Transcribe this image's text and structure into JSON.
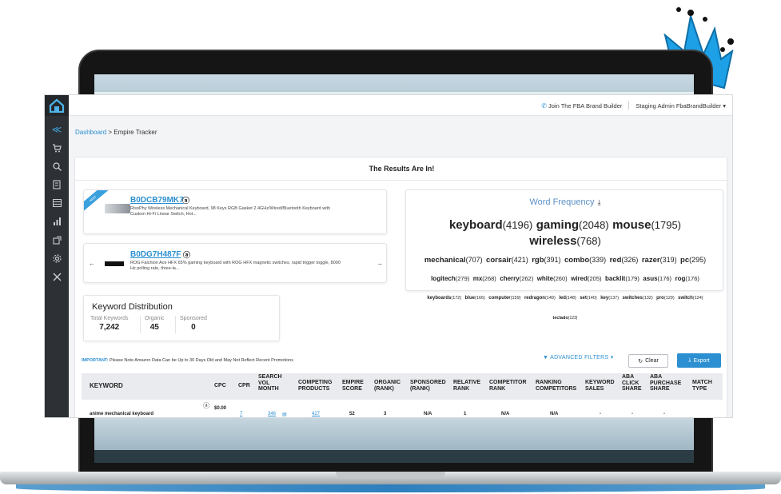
{
  "topbar": {
    "join_label": "Join The FBA Brand Builder",
    "user_label": "Staging Admin FbaBrandBuilder"
  },
  "breadcrumb": {
    "root": "Dashboard",
    "separator": ">",
    "current": "Empire Tracker"
  },
  "results_title": "The Results Are In!",
  "products": [
    {
      "asin": "B0DCB79MK7",
      "badge": "ⓐ",
      "ribbon": "NEW",
      "description_line1": "RisoPhy Wireless Mechanical Keyboard, 98 Keys RGB Gasket 2.4GHz/Wired/Bluetooth Keyboard with",
      "description_line2": "Custom Hi-Fi Linear Switch, Hot..."
    },
    {
      "asin": "B0DG7H487F",
      "badge": "ⓐ",
      "description_line1": "ROG Falchion Ace HFX 65% gaming keyboard with ROG HFX magnetic switches, rapid trigger toggle, 8000",
      "description_line2": "Hz polling rate, three-la..."
    }
  ],
  "word_frequency": {
    "title": "Word Frequency",
    "download_glyph": "⤓",
    "rows": [
      [
        {
          "word": "keyboard",
          "count": "(4196)"
        },
        {
          "word": "gaming",
          "count": "(2048)"
        },
        {
          "word": "mouse",
          "count": "(1795)"
        },
        {
          "word": "wireless",
          "count": "(768)"
        }
      ],
      [
        {
          "word": "mechanical",
          "count": "(707)"
        },
        {
          "word": "corsair",
          "count": "(421)"
        },
        {
          "word": "rgb",
          "count": "(391)"
        },
        {
          "word": "combo",
          "count": "(339)"
        },
        {
          "word": "red",
          "count": "(326)"
        },
        {
          "word": "razer",
          "count": "(319)"
        },
        {
          "word": "pc",
          "count": "(295)"
        }
      ],
      [
        {
          "word": "logitech",
          "count": "(279)"
        },
        {
          "word": "mx",
          "count": "(268)"
        },
        {
          "word": "cherry",
          "count": "(262)"
        },
        {
          "word": "white",
          "count": "(260)"
        },
        {
          "word": "wired",
          "count": "(205)"
        },
        {
          "word": "backlit",
          "count": "(179)"
        },
        {
          "word": "asus",
          "count": "(176)"
        },
        {
          "word": "rog",
          "count": "(176)"
        }
      ],
      [
        {
          "word": "keyboards",
          "count": "(172)"
        },
        {
          "word": "blue",
          "count": "(166)"
        },
        {
          "word": "computer",
          "count": "(159)"
        },
        {
          "word": "redragon",
          "count": "(149)"
        },
        {
          "word": "led",
          "count": "(148)"
        },
        {
          "word": "set",
          "count": "(140)"
        },
        {
          "word": "key",
          "count": "(137)"
        },
        {
          "word": "switches",
          "count": "(132)"
        },
        {
          "word": "pro",
          "count": "(129)"
        },
        {
          "word": "switch",
          "count": "(124)"
        }
      ],
      [
        {
          "word": "teclado",
          "count": "(123)"
        }
      ]
    ]
  },
  "keyword_distribution": {
    "title": "Keyword Distribution",
    "total_label": "Total Keywords",
    "total_value": "7,242",
    "organic_label": "Organic",
    "organic_value": "45",
    "sponsored_label": "Sponsored",
    "sponsored_value": "0"
  },
  "notice": {
    "important": "IMPORTANT:",
    "text": "Please Note Amazon Data Can be Up to 30 Days Old and May Not Reflect Recent Promotions"
  },
  "toolbar": {
    "advanced_filters": "ADVANCED FILTERS",
    "clear": "Clear",
    "export": "Export"
  },
  "table": {
    "headers": {
      "keyword": "KEYWORD",
      "cpc": "CPC",
      "cpr": "CPR",
      "search_vol_1": "SEARCH",
      "search_vol_2": "VOL",
      "search_vol_3": "MONTH",
      "competing_1": "Competing",
      "competing_2": "Products",
      "empire_1": "Empire",
      "empire_2": "Score",
      "organic_1": "Organic",
      "organic_2": "(Rank)",
      "sponsored_1": "Sponsored",
      "sponsored_2": "(Rank)",
      "relative_1": "Relative",
      "relative_2": "Rank",
      "competitor_1": "Competitor",
      "competitor_2": "Rank",
      "ranking_1": "Ranking",
      "ranking_2": "Competitors",
      "sales_1": "Keyword",
      "sales_2": "Sales",
      "aba_click_1": "ABA",
      "aba_click_2": "Click",
      "aba_click_3": "Share",
      "aba_purchase_1": "ABA",
      "aba_purchase_2": "Purchase",
      "aba_purchase_3": "Share",
      "match_1": "Match",
      "match_2": "Type"
    },
    "rows": [
      {
        "keyword": "anime mechanical keyboard",
        "badge": "ⓐ",
        "cpc": "$0.00",
        "cpr": "7",
        "search_vol": "346",
        "competing": "427",
        "empire": "52",
        "organic": "3",
        "sponsored": "N/A",
        "relative": "1",
        "competitor": "N/A",
        "ranking": "N/A",
        "sales": "-",
        "aba_click": "-",
        "aba_purchase": "-"
      }
    ]
  },
  "colors": {
    "accent": "#2b8fd1",
    "sidebar": "#2d3136",
    "crown": "#1ea0e6"
  }
}
